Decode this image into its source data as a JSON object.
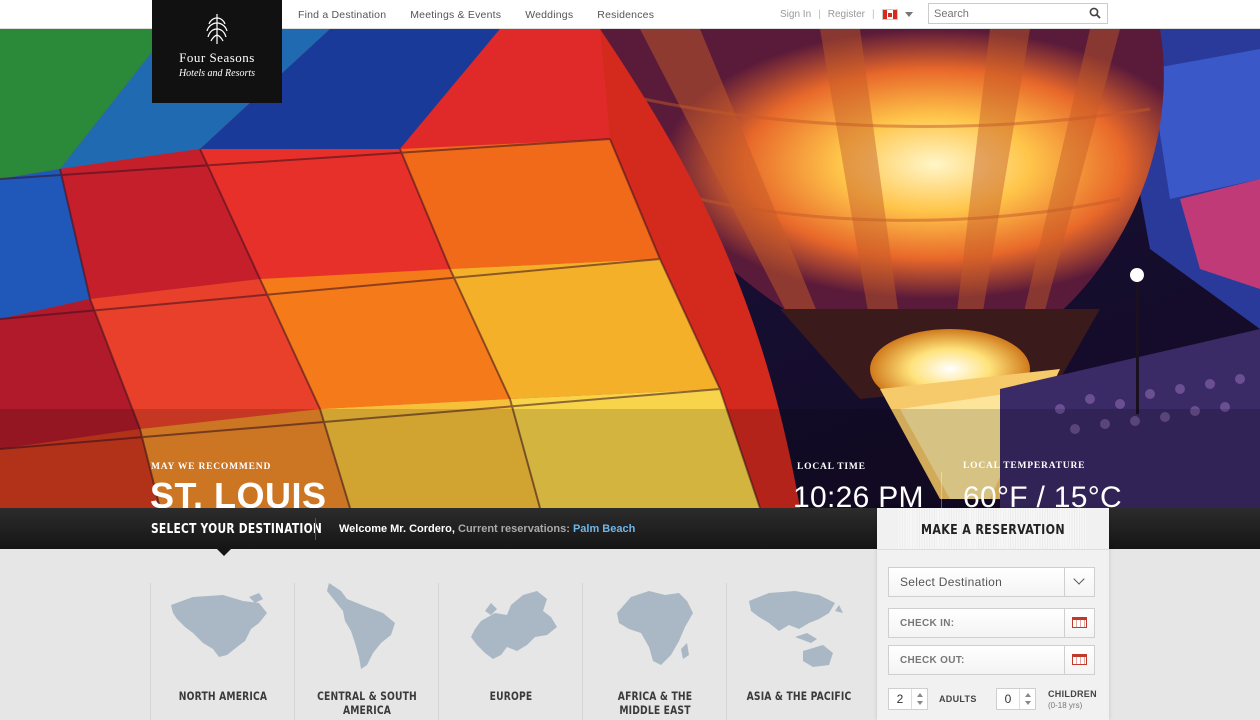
{
  "brand": {
    "name_line1": "Four Seasons",
    "name_line2": "Hotels and Resorts"
  },
  "nav": {
    "items": [
      "Find a Destination",
      "Meetings & Events",
      "Weddings",
      "Residences"
    ]
  },
  "account": {
    "sign_in": "Sign In",
    "sep": "|",
    "register": "Register"
  },
  "search": {
    "placeholder": "Search"
  },
  "hero": {
    "recommend_label": "MAY WE RECOMMEND",
    "city": "ST. LOUIS",
    "local_time_label": "LOCAL TIME",
    "local_time": "10:26 PM",
    "local_temp_label": "LOCAL TEMPERATURE",
    "local_temp": "60°F / 15°C"
  },
  "strip": {
    "select_destination": "SELECT YOUR DESTINATION",
    "welcome": "Welcome Mr. Cordero,",
    "current_label": "Current reservations:",
    "current_value": "Palm Beach"
  },
  "regions": [
    "NORTH AMERICA",
    "CENTRAL & SOUTH AMERICA",
    "EUROPE",
    "AFRICA & THE MIDDLE EAST",
    "ASIA & THE PACIFIC"
  ],
  "reservation": {
    "title": "MAKE A RESERVATION",
    "select_destination": "Select Destination",
    "check_in": "CHECK IN:",
    "check_out": "CHECK OUT:",
    "adults_value": "2",
    "adults_label": "ADULTS",
    "children_value": "0",
    "children_label": "CHILDREN",
    "children_ages": "(0-18 yrs)"
  },
  "colors": {
    "link_blue": "#6fb6e8",
    "flag_red": "#d52b1e",
    "panel_bg": "#f1f1f1"
  }
}
